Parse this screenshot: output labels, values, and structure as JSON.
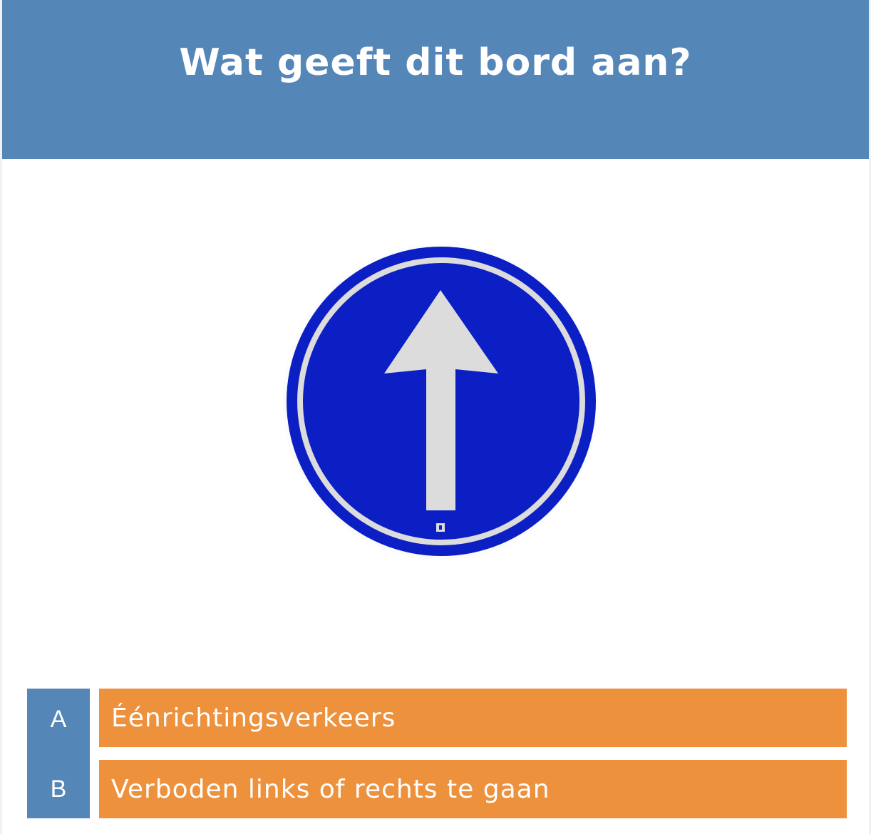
{
  "question": {
    "title": "Wat geeft dit bord aan?"
  },
  "sign": {
    "icon": "straight-ahead-arrow-sign-icon",
    "background_color": "#0b1fc4",
    "arrow_color": "#dcdcdc"
  },
  "answers": [
    {
      "letter": "A",
      "text": "Éénrichtingsverkeers"
    },
    {
      "letter": "B",
      "text": "Verboden links of rechts te gaan"
    }
  ],
  "colors": {
    "header": "#5586b8",
    "answer_bar": "#ed913d",
    "letter_column": "#5586b8"
  }
}
